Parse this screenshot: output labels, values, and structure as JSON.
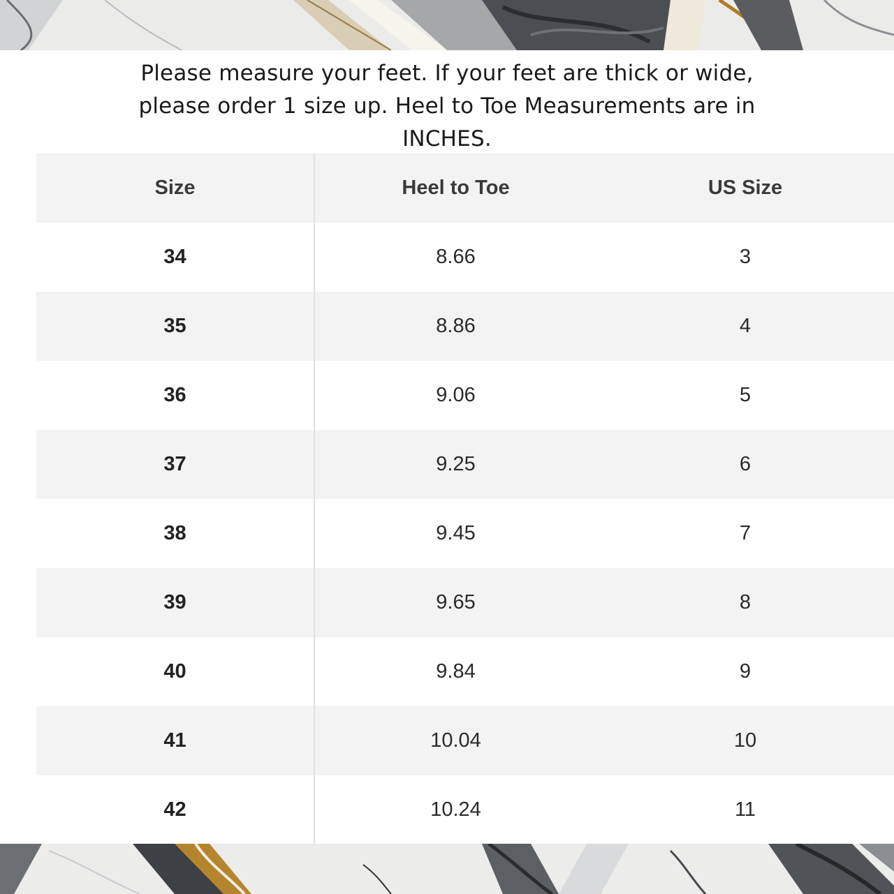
{
  "instructions": "Please measure your feet. If your feet are thick or wide, please order 1 size up. Heel to Toe Measurements are in INCHES.",
  "table": {
    "headers": [
      "Size",
      "Heel to Toe",
      "US Size"
    ],
    "rows": [
      [
        "34",
        "8.66",
        "3"
      ],
      [
        "35",
        "8.86",
        "4"
      ],
      [
        "36",
        "9.06",
        "5"
      ],
      [
        "37",
        "9.25",
        "6"
      ],
      [
        "38",
        "9.45",
        "7"
      ],
      [
        "39",
        "9.65",
        "8"
      ],
      [
        "40",
        "9.84",
        "9"
      ],
      [
        "41",
        "10.04",
        "10"
      ],
      [
        "42",
        "10.24",
        "11"
      ]
    ]
  },
  "colors": {
    "row_stripe": "#f2f3f2",
    "background": "#ffffff",
    "marble_base": "#e9e9e7",
    "marble_vein_dark": "#3f4246",
    "marble_vein_gold": "#b8862f"
  }
}
